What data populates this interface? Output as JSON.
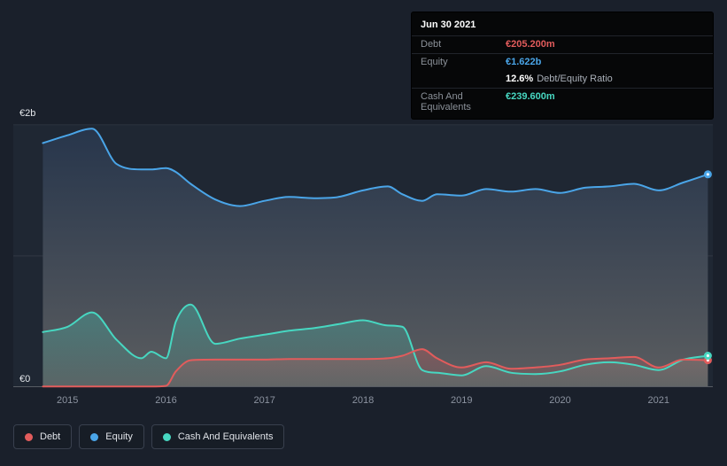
{
  "tooltip": {
    "date": "Jun 30 2021",
    "debt_label": "Debt",
    "debt_value": "€205.200m",
    "equity_label": "Equity",
    "equity_value": "€1.622b",
    "ratio_value": "12.6%",
    "ratio_label": "Debt/Equity Ratio",
    "cash_label": "Cash And Equivalents",
    "cash_value": "€239.600m"
  },
  "legend": {
    "debt": "Debt",
    "equity": "Equity",
    "cash": "Cash And Equivalents"
  },
  "chart_data": {
    "type": "area",
    "units": "EUR billions",
    "x": [
      2014.75,
      2015.0,
      2015.25,
      2015.5,
      2015.75,
      2015.85,
      2016.0,
      2016.1,
      2016.25,
      2016.5,
      2016.75,
      2017.0,
      2017.25,
      2017.5,
      2017.75,
      2018.0,
      2018.25,
      2018.4,
      2018.6,
      2018.75,
      2019.0,
      2019.25,
      2019.5,
      2019.75,
      2020.0,
      2020.25,
      2020.5,
      2020.75,
      2021.0,
      2021.25,
      2021.5
    ],
    "series": [
      {
        "key": "equity",
        "name": "Equity",
        "color": "#4aa5e8",
        "values": [
          1.86,
          1.92,
          1.97,
          1.7,
          1.66,
          1.66,
          1.67,
          1.64,
          1.55,
          1.43,
          1.38,
          1.42,
          1.45,
          1.44,
          1.45,
          1.5,
          1.53,
          1.47,
          1.42,
          1.47,
          1.46,
          1.51,
          1.49,
          1.51,
          1.48,
          1.52,
          1.53,
          1.55,
          1.5,
          1.56,
          1.622
        ]
      },
      {
        "key": "cash",
        "name": "Cash And Equivalents",
        "color": "#47d7c1",
        "values": [
          0.42,
          0.46,
          0.57,
          0.36,
          0.22,
          0.27,
          0.22,
          0.5,
          0.63,
          0.33,
          0.37,
          0.4,
          0.43,
          0.45,
          0.48,
          0.51,
          0.47,
          0.46,
          0.13,
          0.11,
          0.09,
          0.16,
          0.11,
          0.1,
          0.12,
          0.17,
          0.19,
          0.17,
          0.13,
          0.21,
          0.2396
        ]
      },
      {
        "key": "debt",
        "name": "Debt",
        "color": "#e25c5c",
        "values": [
          0.005,
          0.005,
          0.005,
          0.005,
          0.005,
          0.005,
          0.01,
          0.12,
          0.205,
          0.21,
          0.21,
          0.21,
          0.215,
          0.215,
          0.215,
          0.215,
          0.22,
          0.24,
          0.29,
          0.22,
          0.15,
          0.19,
          0.14,
          0.15,
          0.17,
          0.21,
          0.22,
          0.23,
          0.15,
          0.21,
          0.2052
        ]
      }
    ],
    "xlim": [
      2014.45,
      2021.55
    ],
    "ylim": [
      0,
      2.1
    ],
    "x_ticks": [
      2015,
      2016,
      2017,
      2018,
      2019,
      2020,
      2021
    ],
    "y_ticks": [
      {
        "value": 0,
        "label": "€0"
      },
      {
        "value": 2,
        "label": "€2b"
      }
    ],
    "gridlines": [
      1,
      2
    ],
    "grid": true,
    "legend_position": "bottom"
  }
}
